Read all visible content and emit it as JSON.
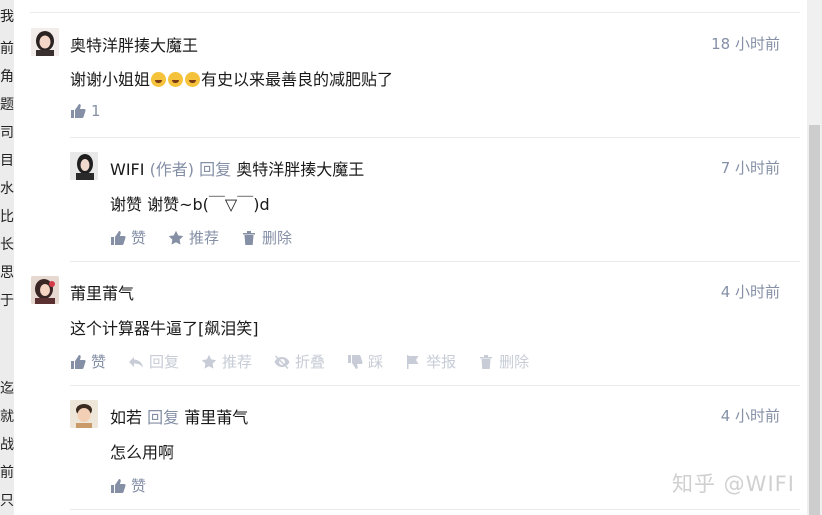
{
  "left_strip": {
    "chars": [
      "我",
      "前",
      "角",
      "题",
      "司",
      "目",
      "水",
      "比",
      "长",
      "思",
      "于",
      "迄",
      "就",
      "战",
      "前",
      "只"
    ]
  },
  "comments": [
    {
      "author": "奥特洋胖揍大魔王",
      "time": "18 小时前",
      "text_before": "谢谢小姐姐",
      "emoji_icons": [
        "crying-laughing-emoji-icon",
        "crying-laughing-emoji-icon",
        "crying-laughing-emoji-icon"
      ],
      "text_after": "有史以来最善良的减肥贴了",
      "like_count": "1"
    },
    {
      "author": "WIFI",
      "author_role": "(作者)",
      "reply_word": "回复",
      "reply_to": "奥特洋胖揍大魔王",
      "time": "7 小时前",
      "text": "谢赞 谢赞~b(￣▽￣)d",
      "actions": {
        "like": "赞",
        "recommend": "推荐",
        "delete": "删除"
      }
    },
    {
      "author": "莆里莆气",
      "time": "4 小时前",
      "text": "这个计算器牛逼了[飙泪笑]",
      "actions": {
        "like": "赞",
        "reply": "回复",
        "recommend": "推荐",
        "fold": "折叠",
        "dislike": "踩",
        "report": "举报",
        "delete": "删除"
      }
    },
    {
      "author": "如若",
      "reply_word": "回复",
      "reply_to": "莆里莆气",
      "time": "4 小时前",
      "text": "怎么用啊",
      "actions": {
        "like": "赞"
      }
    }
  ],
  "watermark": "知乎 @WIFI"
}
